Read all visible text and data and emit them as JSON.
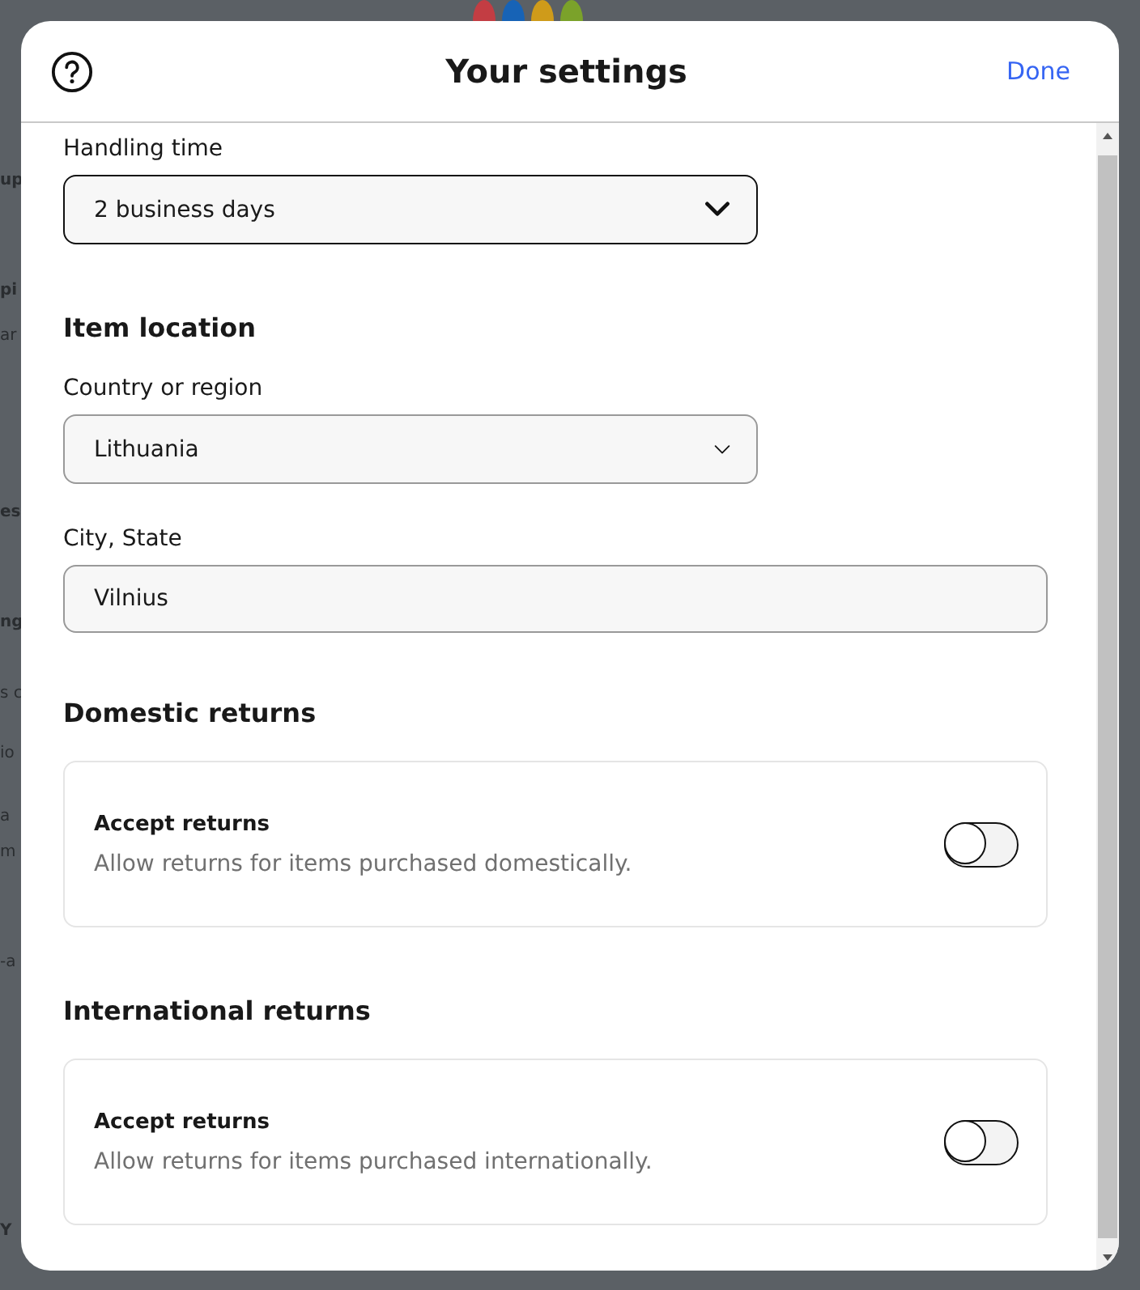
{
  "backdrop": {
    "fragments": [
      {
        "text": "up",
        "kind": "heading"
      },
      {
        "text": "pi",
        "kind": "heading"
      },
      {
        "text": "ar",
        "kind": "text"
      },
      {
        "text": "es",
        "kind": "heading"
      },
      {
        "text": "ng",
        "kind": "heading"
      },
      {
        "text": "s c",
        "kind": "text"
      },
      {
        "text": "io",
        "kind": "text"
      },
      {
        "text": "a",
        "kind": "text"
      },
      {
        "text": "m",
        "kind": "text"
      },
      {
        "text": "-a",
        "kind": "text"
      },
      {
        "text": "Y",
        "kind": "heading"
      }
    ]
  },
  "dialog": {
    "title": "Your settings",
    "done": "Done"
  },
  "sections": [
    {
      "fields": [
        {
          "kind": "select",
          "label": "Handling time",
          "value": "2 business days",
          "focused": true
        }
      ]
    },
    {
      "heading": "Item location",
      "fields": [
        {
          "kind": "select",
          "label": "Country or region",
          "value": "Lithuania",
          "focused": false
        },
        {
          "kind": "input",
          "label": "City, State",
          "value": "Vilnius",
          "focused": false
        }
      ]
    },
    {
      "heading": "Domestic returns",
      "card": {
        "title": "Accept returns",
        "description": "Allow returns for items purchased domestically.",
        "on": false
      }
    },
    {
      "heading": "International returns",
      "card": {
        "title": "Accept returns",
        "description": "Allow returns for items purchased internationally.",
        "on": false
      }
    }
  ]
}
